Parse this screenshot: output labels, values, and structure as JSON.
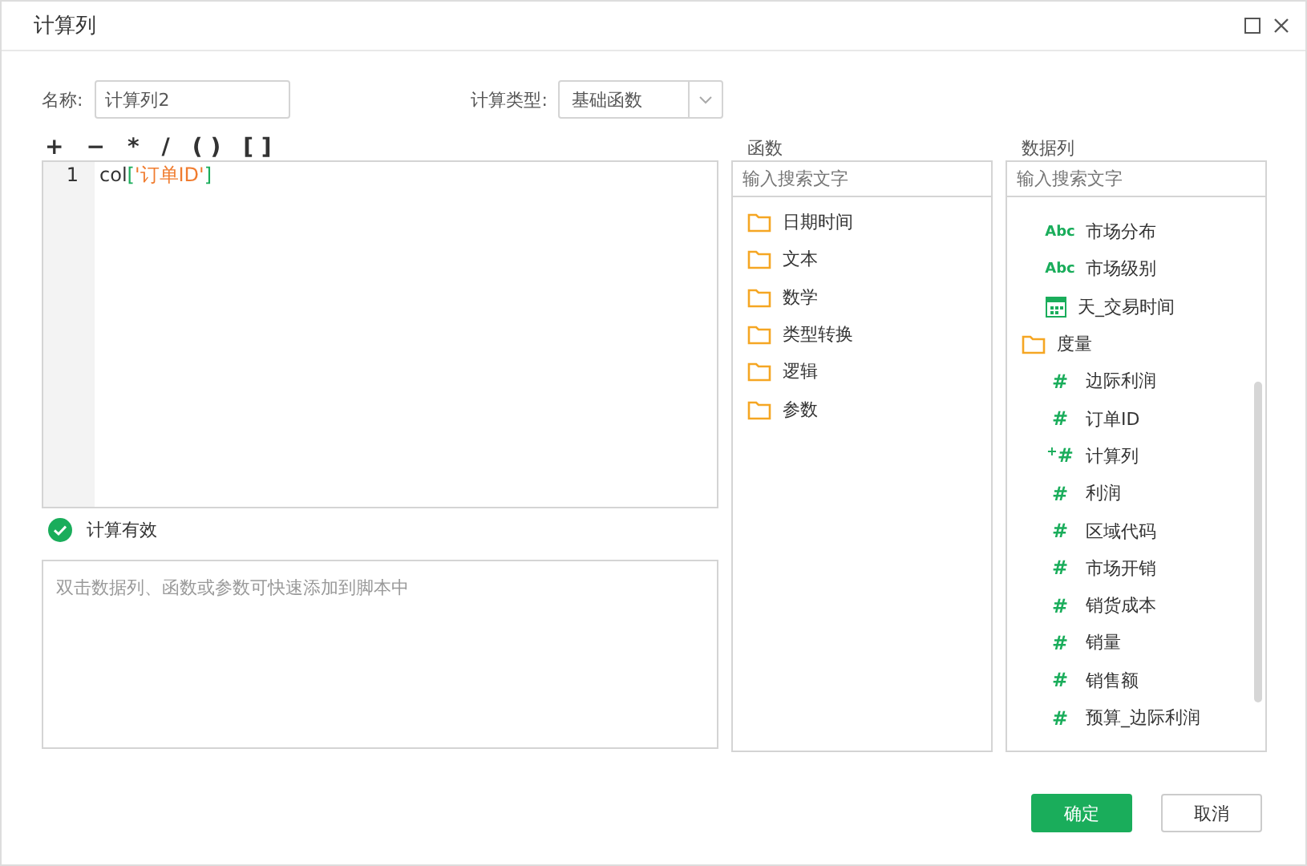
{
  "window": {
    "title": "计算列"
  },
  "name_field": {
    "label": "名称:",
    "value": "计算列2"
  },
  "calc_type": {
    "label": "计算类型:",
    "value": "基础函数"
  },
  "operators": [
    "+",
    "−",
    "*",
    "/",
    "( )",
    "[ ]"
  ],
  "editor": {
    "lines": [
      {
        "number": "1",
        "prefix": "col",
        "open": "[",
        "string": "'订单ID'",
        "close": "]"
      }
    ]
  },
  "validation": {
    "valid": true,
    "message": "计算有效"
  },
  "hint_box": {
    "placeholder": "双击数据列、函数或参数可快速添加到脚本中"
  },
  "functions": {
    "title": "函数",
    "search": {
      "placeholder": "输入搜索文字"
    },
    "items": [
      {
        "label": "日期时间",
        "kind": "folder"
      },
      {
        "label": "文本",
        "kind": "folder"
      },
      {
        "label": "数学",
        "kind": "folder"
      },
      {
        "label": "类型转换",
        "kind": "folder"
      },
      {
        "label": "逻辑",
        "kind": "folder"
      },
      {
        "label": "参数",
        "kind": "folder"
      }
    ]
  },
  "data_columns": {
    "title": "数据列",
    "search": {
      "placeholder": "输入搜索文字"
    },
    "items": [
      {
        "label": "市场分布",
        "kind": "text",
        "badge": "Abc"
      },
      {
        "label": "市场级别",
        "kind": "text",
        "badge": "Abc"
      },
      {
        "label": "天_交易时间",
        "kind": "date"
      },
      {
        "label": "度量",
        "kind": "folder",
        "children": [
          {
            "label": "边际利润",
            "kind": "measure",
            "badge": "#"
          },
          {
            "label": "订单ID",
            "kind": "measure",
            "badge": "#"
          },
          {
            "label": "计算列",
            "kind": "calc",
            "badge": "$^{+}$#"
          },
          {
            "label": "利润",
            "kind": "measure",
            "badge": "#"
          },
          {
            "label": "区域代码",
            "kind": "measure",
            "badge": "#"
          },
          {
            "label": "市场开销",
            "kind": "measure",
            "badge": "#"
          },
          {
            "label": "销货成本",
            "kind": "measure",
            "badge": "#"
          },
          {
            "label": "销量",
            "kind": "measure",
            "badge": "#"
          },
          {
            "label": "销售额",
            "kind": "measure",
            "badge": "#"
          },
          {
            "label": "预算_边际利润",
            "kind": "measure",
            "badge": "#"
          }
        ]
      }
    ]
  },
  "buttons": [
    {
      "label": "确定",
      "kind": "primary"
    },
    {
      "label": "取消",
      "kind": "secondary"
    }
  ]
}
